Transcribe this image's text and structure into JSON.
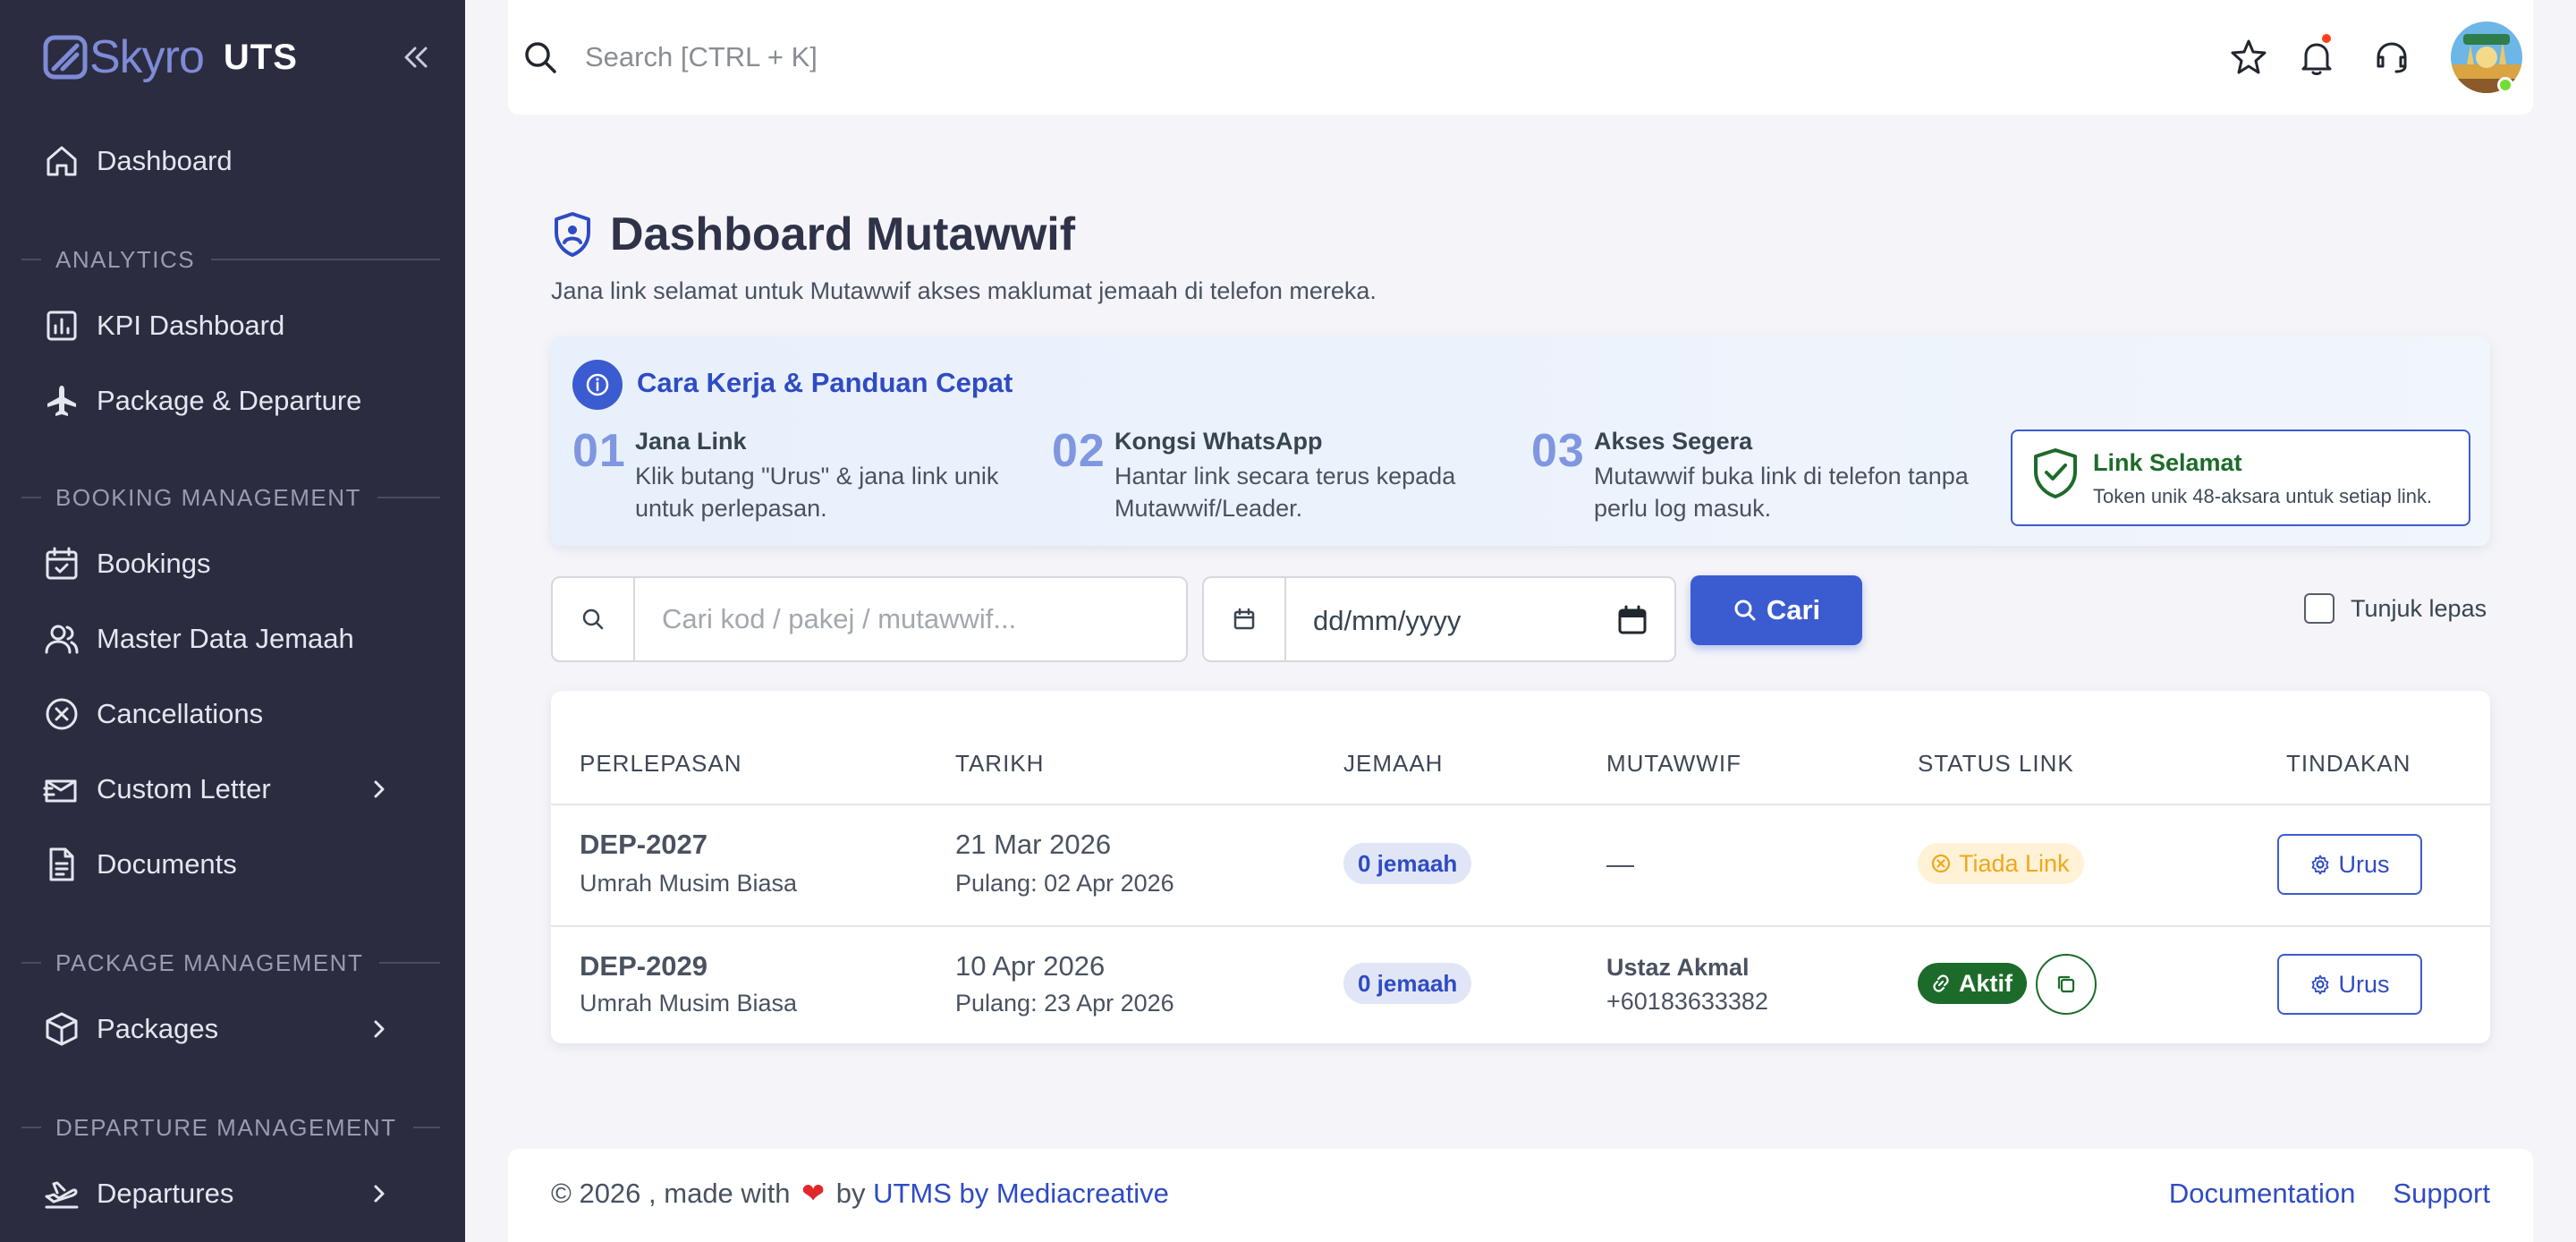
{
  "brand": {
    "name": "Skyro",
    "suffix": "UTS"
  },
  "sidebar": {
    "items": [
      {
        "label": "Dashboard"
      },
      {
        "section": "ANALYTICS"
      },
      {
        "label": "KPI Dashboard"
      },
      {
        "label": "Package & Departure"
      },
      {
        "section": "BOOKING MANAGEMENT"
      },
      {
        "label": "Bookings"
      },
      {
        "label": "Master Data Jemaah"
      },
      {
        "label": "Cancellations"
      },
      {
        "label": "Custom Letter"
      },
      {
        "label": "Documents"
      },
      {
        "section": "PACKAGE MANAGEMENT"
      },
      {
        "label": "Packages"
      },
      {
        "section": "DEPARTURE MANAGEMENT"
      },
      {
        "label": "Departures"
      }
    ]
  },
  "topbar": {
    "search_placeholder": "Search [CTRL + K]",
    "icons": [
      "star-icon",
      "bell-icon",
      "headset-icon"
    ]
  },
  "page": {
    "title": "Dashboard Mutawwif",
    "subtitle": "Jana link selamat untuk Mutawwif akses maklumat jemaah di telefon mereka."
  },
  "guide": {
    "title": "Cara Kerja & Panduan Cepat",
    "steps": [
      {
        "num": "01",
        "title": "Jana Link",
        "text": "Klik butang \"Urus\" & jana link unik untuk perlepasan."
      },
      {
        "num": "02",
        "title": "Kongsi WhatsApp",
        "text": "Hantar link secara terus kepada Mutawwif/Leader."
      },
      {
        "num": "03",
        "title": "Akses Segera",
        "text": "Mutawwif buka link di telefon tanpa perlu log masuk."
      }
    ],
    "secure": {
      "title": "Link Selamat",
      "text": "Token unik 48-aksara untuk setiap link."
    }
  },
  "filters": {
    "search_placeholder": "Cari kod / pakej / mutawwif...",
    "date_placeholder": "dd/mm/yyyy",
    "search_button": "Cari",
    "show_past": "Tunjuk lepas"
  },
  "table": {
    "headers": [
      "PERLEPASAN",
      "TARIKH",
      "JEMAAH",
      "MUTAWWIF",
      "STATUS LINK",
      "TINDAKAN"
    ],
    "rows": [
      {
        "code": "DEP-2027",
        "package": "Umrah Musim Biasa",
        "date": "21 Mar 2026",
        "return": "Pulang: 02 Apr 2026",
        "jemaah": "0 jemaah",
        "mutawwif_name": "—",
        "mutawwif_phone": "",
        "status": "Tiada Link",
        "status_type": "none",
        "action": "Urus"
      },
      {
        "code": "DEP-2029",
        "package": "Umrah Musim Biasa",
        "date": "10 Apr 2026",
        "return": "Pulang: 23 Apr 2026",
        "jemaah": "0 jemaah",
        "mutawwif_name": "Ustaz Akmal",
        "mutawwif_phone": "+60183633382",
        "status": "Aktif",
        "status_type": "active",
        "action": "Urus"
      }
    ]
  },
  "footer": {
    "prefix": "© 2026 , made with ",
    "by": " by ",
    "link": "UTMS by Mediacreative",
    "links": [
      "Documentation",
      "Support"
    ]
  },
  "colors": {
    "sidebar_bg": "#2b2c40",
    "primary": "#3b5bd1",
    "success": "#1d6b2a",
    "warning": "#f0a71a"
  }
}
